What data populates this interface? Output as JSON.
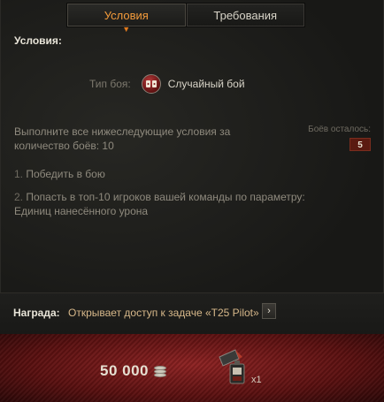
{
  "tabs": {
    "conditions": "Условия",
    "requirements": "Требования"
  },
  "section_title": "Условия:",
  "battle_type": {
    "label": "Тип боя:",
    "value": "Случайный бой",
    "icon": "random-battle-icon"
  },
  "description": "Выполните все нижеследующие условия за количество боёв: 10",
  "battles_left": {
    "label": "Боёв осталось:",
    "value": "5"
  },
  "conditions": [
    {
      "num": "1.",
      "text": "Победить в бою"
    },
    {
      "num": "2.",
      "text": "Попасть в топ-10 игроков вашей команды по параметру: Единиц нанесённого урона"
    }
  ],
  "reward": {
    "label": "Награда:",
    "text": "Открывает доступ к задаче «T25 Pilot»",
    "arrow": "›"
  },
  "rewards": {
    "credits": "50 000",
    "credits_icon": "credits-icon",
    "item_icon": "consumable-item-icon",
    "item_count": "x1"
  },
  "colors": {
    "accent": "#f39b3b",
    "reward_bg": "#8e2222"
  }
}
